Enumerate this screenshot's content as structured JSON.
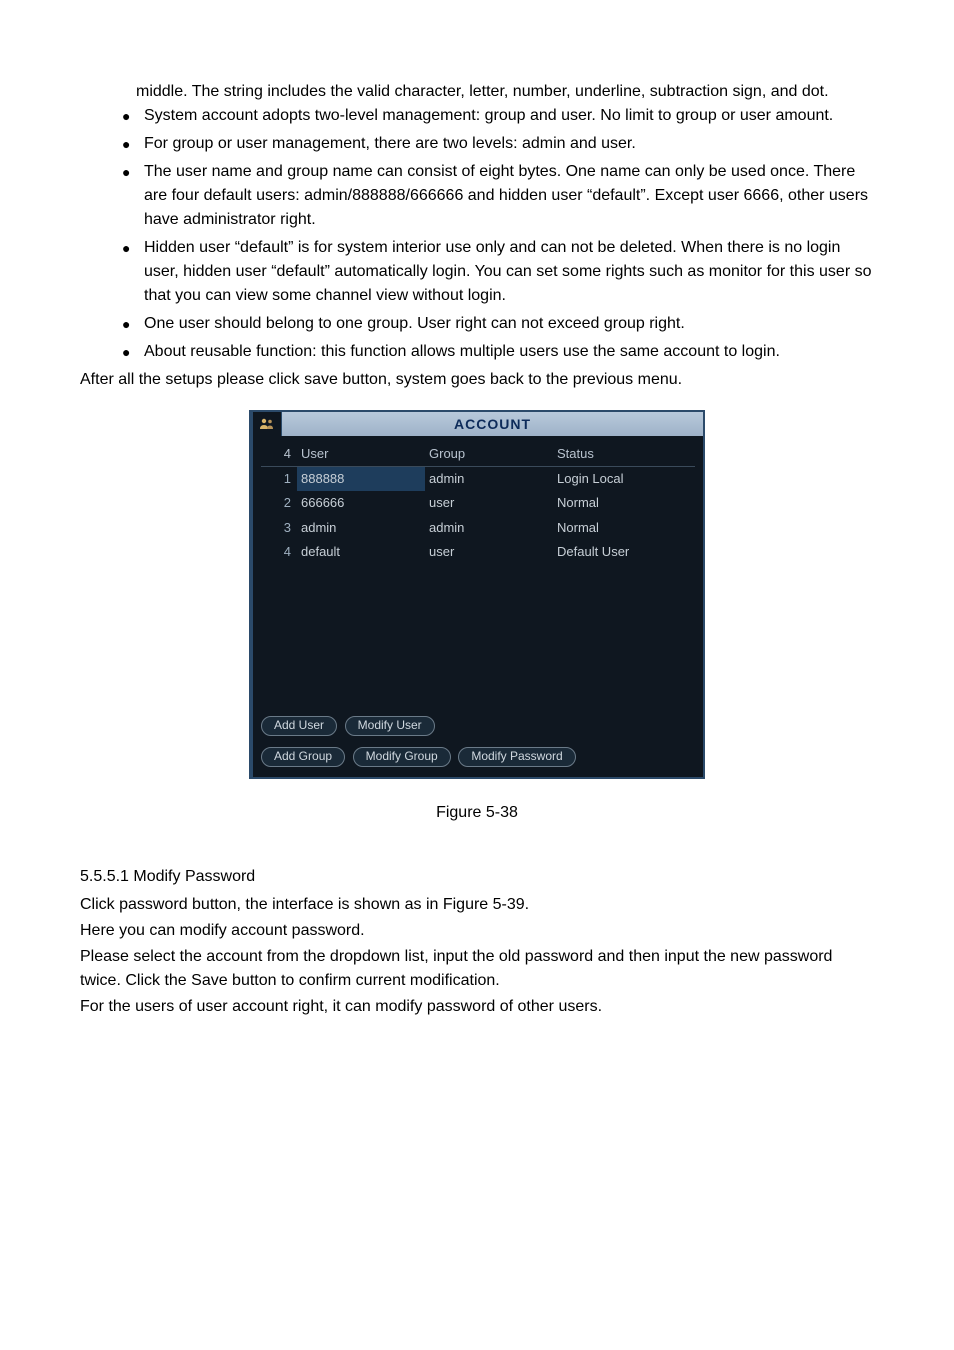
{
  "lead_in": "middle. The string includes the valid character, letter, number, underline, subtraction sign, and dot.",
  "bullets": [
    "System account adopts two-level management: group and user. No limit to group or user amount.",
    "For group or user management, there are two levels: admin and user.",
    "The user name and group name can consist of eight bytes. One name can only be used once. There are four default users: admin/888888/666666 and hidden user “default”. Except user 6666, other users have administrator right.",
    "Hidden user “default” is for system interior use only and can not be deleted. When there is no login user, hidden user “default” automatically login. You can set some rights such as monitor for this user so that you can view some channel view without login.",
    "One user should belong to one group. User right can not exceed group right.",
    "About reusable function: this function allows multiple users use the same account to login."
  ],
  "after_bullets": "After all the setups please click save button, system goes back to the previous menu.",
  "account": {
    "title": "ACCOUNT",
    "count": "4",
    "headers": {
      "user": "User",
      "group": "Group",
      "status": "Status"
    },
    "rows": [
      {
        "n": "1",
        "user": "888888",
        "group": "admin",
        "status": "Login Local"
      },
      {
        "n": "2",
        "user": "666666",
        "group": "user",
        "status": "Normal"
      },
      {
        "n": "3",
        "user": "admin",
        "group": "admin",
        "status": "Normal"
      },
      {
        "n": "4",
        "user": "default",
        "group": "user",
        "status": "Default User"
      }
    ],
    "buttons": {
      "add_user": "Add User",
      "modify_user": "Modify User",
      "add_group": "Add Group",
      "modify_group": "Modify Group",
      "modify_password": "Modify Password"
    }
  },
  "figure_caption": "Figure 5-38",
  "subhead": "5.5.5.1  Modify Password",
  "paras": [
    "Click password button, the interface is shown as in Figure 5-39.",
    "Here you can modify account password.",
    "Please select the account from the dropdown list, input the old password and then input the new password twice. Click the Save button to confirm current modification.",
    "For the users of user account right, it can modify password of other users."
  ]
}
